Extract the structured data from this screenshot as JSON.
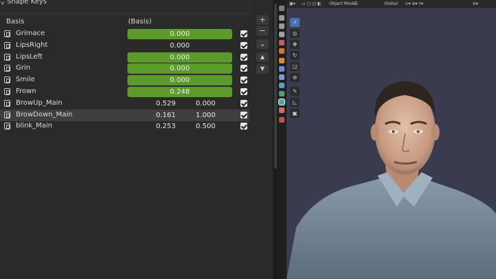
{
  "panel": {
    "title": "Shape Keys",
    "chevron": "v"
  },
  "columns": {
    "name": "Basis",
    "value": "(Basis)"
  },
  "shape_keys": [
    {
      "name": "Grimace",
      "value": "0.000",
      "style": "slider"
    },
    {
      "name": "LipsRight",
      "value": "0.000",
      "style": "plain"
    },
    {
      "name": "LipsLeft",
      "value": "0.000",
      "style": "slider"
    },
    {
      "name": "Grin",
      "value": "0.000",
      "style": "slider"
    },
    {
      "name": "Smile",
      "value": "0.000",
      "style": "slider"
    },
    {
      "name": "Frown",
      "value": "0.248",
      "style": "slider"
    },
    {
      "name": "BrowUp_Main",
      "value": "0.529",
      "value2": "0.000",
      "style": "split"
    },
    {
      "name": "BrowDown_Main",
      "value": "0.161",
      "value2": "1.000",
      "style": "split",
      "selected": true
    },
    {
      "name": "blink_Main",
      "value": "0.253",
      "value2": "0.500",
      "style": "split"
    }
  ],
  "side_buttons": {
    "add": "+",
    "remove": "−",
    "specials": "⌄",
    "up": "▲",
    "down": "▼"
  },
  "viewport": {
    "mode": "Object Mode",
    "orientation": "Global"
  },
  "colors": {
    "slider_green": "#5c9a2c",
    "active_tool": "#4772b3"
  }
}
